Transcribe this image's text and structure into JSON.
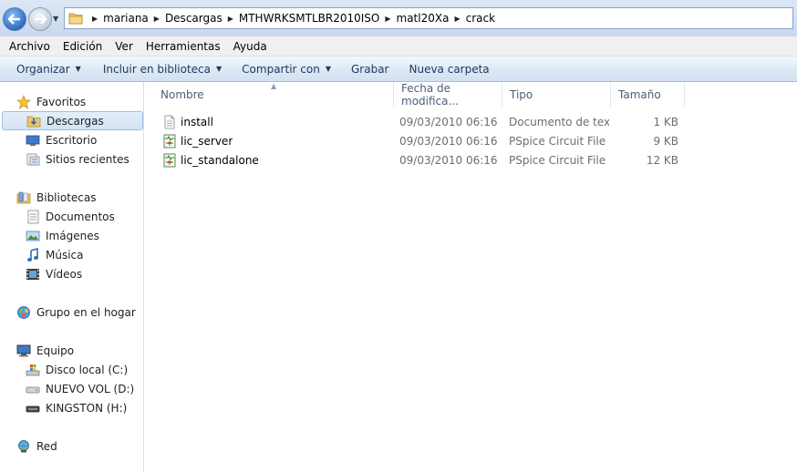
{
  "address": {
    "path": [
      "mariana",
      "Descargas",
      "MTHWRKSMTLBR2010ISO",
      "matl20Xa",
      "crack"
    ]
  },
  "menu": [
    "Archivo",
    "Edición",
    "Ver",
    "Herramientas",
    "Ayuda"
  ],
  "commands": {
    "organize": "Organizar",
    "include": "Incluir en biblioteca",
    "share": "Compartir con",
    "burn": "Grabar",
    "new_folder": "Nueva carpeta"
  },
  "nav": {
    "favorites": {
      "label": "Favoritos",
      "items": [
        "Descargas",
        "Escritorio",
        "Sitios recientes"
      ],
      "selected": "Descargas"
    },
    "libraries": {
      "label": "Bibliotecas",
      "items": [
        "Documentos",
        "Imágenes",
        "Música",
        "Vídeos"
      ]
    },
    "homegroup": {
      "label": "Grupo en el hogar"
    },
    "computer": {
      "label": "Equipo",
      "items": [
        "Disco local (C:)",
        "NUEVO VOL (D:)",
        "KINGSTON (H:)"
      ]
    },
    "network": {
      "label": "Red"
    }
  },
  "columns": {
    "name": "Nombre",
    "date": "Fecha de modifica...",
    "type": "Tipo",
    "size": "Tamaño"
  },
  "files": [
    {
      "name": "install",
      "date": "09/03/2010 06:16 ...",
      "type": "Documento de tex...",
      "size": "1 KB",
      "icon": "text-document-icon"
    },
    {
      "name": "lic_server",
      "date": "09/03/2010 06:16 ...",
      "type": "PSpice Circuit File",
      "size": "9 KB",
      "icon": "circuit-file-icon"
    },
    {
      "name": "lic_standalone",
      "date": "09/03/2010 06:16 ...",
      "type": "PSpice Circuit File",
      "size": "12 KB",
      "icon": "circuit-file-icon"
    }
  ]
}
